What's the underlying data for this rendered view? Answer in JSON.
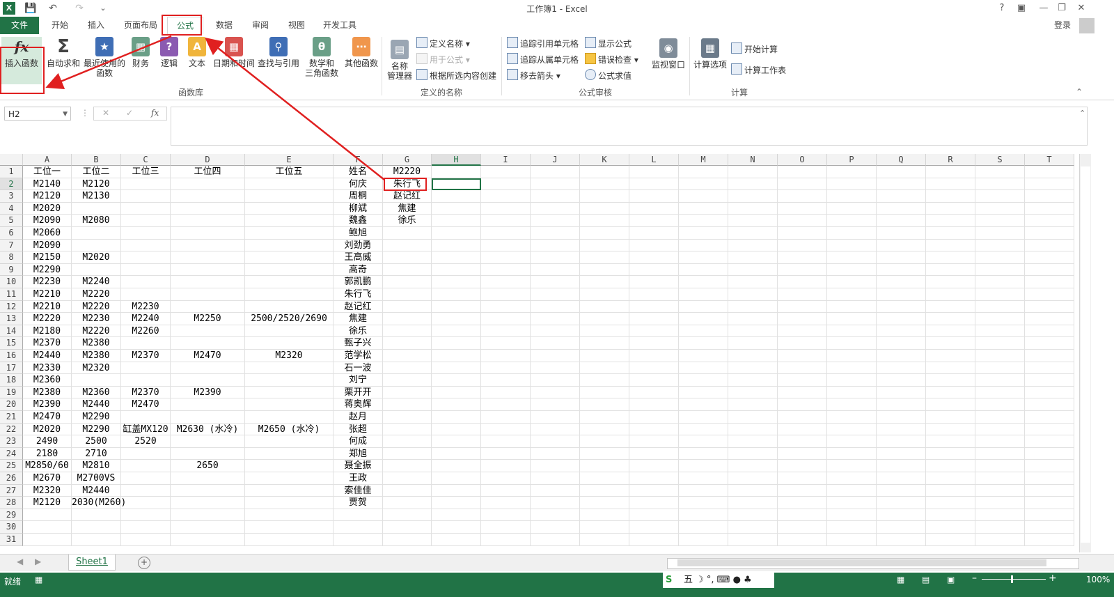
{
  "window": {
    "title": "工作簿1 - Excel",
    "login": "登录",
    "help": "?"
  },
  "tabs": [
    {
      "label": "文件"
    },
    {
      "label": "开始"
    },
    {
      "label": "插入"
    },
    {
      "label": "页面布局"
    },
    {
      "label": "公式"
    },
    {
      "label": "数据"
    },
    {
      "label": "审阅"
    },
    {
      "label": "视图"
    },
    {
      "label": "开发工具"
    }
  ],
  "ribbon": {
    "function_library": {
      "group_label": "函数库",
      "insert_function": "插入函数",
      "autosum": "自动求和",
      "recently_used": "最近使用的\n函数",
      "financial": "财务",
      "logical": "逻辑",
      "text": "文本",
      "datetime": "日期和时间",
      "lookup": "查找与引用",
      "math_trig": "数学和\n三角函数",
      "more": "其他函数"
    },
    "defined_names": {
      "group_label": "定义的名称",
      "name_manager": "名称\n管理器",
      "define_name": "定义名称",
      "use_in_formula": "用于公式",
      "create_from_selection": "根据所选内容创建"
    },
    "formula_auditing": {
      "group_label": "公式审核",
      "trace_precedents": "追踪引用单元格",
      "trace_dependents": "追踪从属单元格",
      "remove_arrows": "移去箭头",
      "show_formulas": "显示公式",
      "error_checking": "错误检查",
      "evaluate_formula": "公式求值",
      "watch_window": "监视窗口"
    },
    "calculation": {
      "group_label": "计算",
      "calc_options": "计算选项",
      "calc_now": "开始计算",
      "calc_sheet": "计算工作表"
    }
  },
  "formula_bar": {
    "name_box": "H2",
    "fx": "fx",
    "content": ""
  },
  "columns": [
    "A",
    "B",
    "C",
    "D",
    "E",
    "F",
    "G",
    "H",
    "I",
    "J",
    "K",
    "L",
    "M",
    "N",
    "O",
    "P",
    "Q",
    "R",
    "S",
    "T"
  ],
  "rows": [
    [
      "工位一",
      "工位二",
      "工位三",
      "工位四",
      "工位五",
      "姓名",
      "M2220"
    ],
    [
      "M2140",
      "M2120",
      "",
      "",
      "",
      "何庆",
      "朱行飞"
    ],
    [
      "M2120",
      "M2130",
      "",
      "",
      "",
      "周桐",
      "赵记红"
    ],
    [
      "M2020",
      "",
      "",
      "",
      "",
      "柳斌",
      "焦建"
    ],
    [
      "M2090",
      "M2080",
      "",
      "",
      "",
      "魏鑫",
      "徐乐"
    ],
    [
      "M2060",
      "",
      "",
      "",
      "",
      "鲍旭",
      ""
    ],
    [
      "M2090",
      "",
      "",
      "",
      "",
      "刘劲勇",
      ""
    ],
    [
      "M2150",
      "M2020",
      "",
      "",
      "",
      "王高威",
      ""
    ],
    [
      "M2290",
      "",
      "",
      "",
      "",
      "高奇",
      ""
    ],
    [
      "M2230",
      "M2240",
      "",
      "",
      "",
      "郭凯鹏",
      ""
    ],
    [
      "M2210",
      "M2220",
      "",
      "",
      "",
      "朱行飞",
      ""
    ],
    [
      "M2210",
      "M2220",
      "M2230",
      "",
      "",
      "赵记红",
      ""
    ],
    [
      "M2220",
      "M2230",
      "M2240",
      "M2250",
      "2500/2520/2690",
      "焦建",
      ""
    ],
    [
      "M2180",
      "M2220",
      "M2260",
      "",
      "",
      "徐乐",
      ""
    ],
    [
      "M2370",
      "M2380",
      "",
      "",
      "",
      "甄子兴",
      ""
    ],
    [
      "M2440",
      "M2380",
      "M2370",
      "M2470",
      "M2320",
      "范学松",
      ""
    ],
    [
      "M2330",
      "M2320",
      "",
      "",
      "",
      "石一波",
      ""
    ],
    [
      "M2360",
      "",
      "",
      "",
      "",
      "刘宁",
      ""
    ],
    [
      "M2380",
      "M2360",
      "M2370",
      "M2390",
      "",
      "栗开开",
      ""
    ],
    [
      "M2390",
      "M2440",
      "M2470",
      "",
      "",
      "蒋奥辉",
      ""
    ],
    [
      "M2470",
      "M2290",
      "",
      "",
      "",
      "赵月",
      ""
    ],
    [
      "M2020",
      "M2290",
      "缸盖MX120",
      "M2630 (水冷)",
      "M2650 (水冷)",
      "张超",
      ""
    ],
    [
      "2490",
      "2500",
      "2520",
      "",
      "",
      "何成",
      ""
    ],
    [
      "2180",
      "2710",
      "",
      "",
      "",
      "郑旭",
      ""
    ],
    [
      "M2850/60",
      "M2810",
      "",
      "2650",
      "",
      "聂全振",
      ""
    ],
    [
      "M2670",
      "M2700VS",
      "",
      "",
      "",
      "王政",
      ""
    ],
    [
      "M2320",
      "M2440",
      "",
      "",
      "",
      "索佳佳",
      ""
    ],
    [
      "M2120",
      "2030(M260)",
      "",
      "",
      "",
      "贾贺",
      ""
    ],
    [
      "",
      "",
      "",
      "",
      "",
      "",
      ""
    ],
    [
      "",
      "",
      "",
      "",
      "",
      "",
      ""
    ],
    [
      "",
      "",
      "",
      "",
      "",
      "",
      ""
    ]
  ],
  "row_numbers": [
    "1",
    "2",
    "3",
    "4",
    "5",
    "6",
    "7",
    "8",
    "9",
    "10",
    "11",
    "12",
    "13",
    "14",
    "15",
    "16",
    "17",
    "18",
    "19",
    "20",
    "21",
    "22",
    "23",
    "24",
    "25",
    "26",
    "27",
    "28",
    "29",
    "30",
    "31"
  ],
  "sheet_tab": "Sheet1",
  "status": {
    "ready": "就绪",
    "zoom": "100%"
  },
  "colors": {
    "excel_green": "#217346",
    "annotation_red": "#e02020"
  }
}
